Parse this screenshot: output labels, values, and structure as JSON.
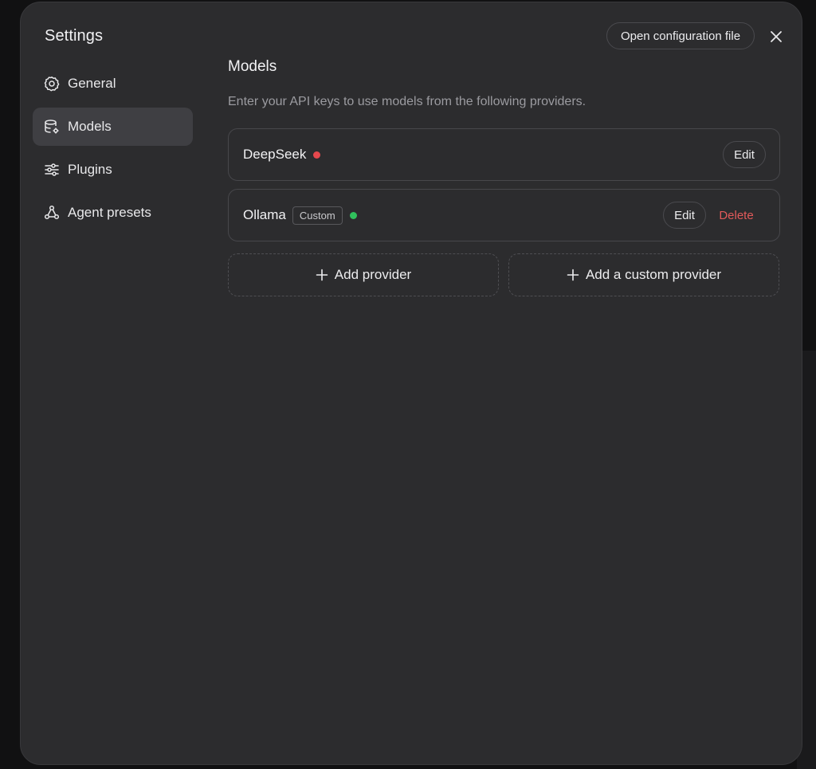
{
  "dialog": {
    "title": "Settings",
    "open_config_label": "Open configuration file",
    "close_icon": "close-icon"
  },
  "sidebar": {
    "items": [
      {
        "label": "General",
        "icon": "gear-icon",
        "active": false
      },
      {
        "label": "Models",
        "icon": "database-gear-icon",
        "active": true
      },
      {
        "label": "Plugins",
        "icon": "sliders-icon",
        "active": false
      },
      {
        "label": "Agent presets",
        "icon": "agent-network-icon",
        "active": false
      }
    ]
  },
  "main": {
    "title": "Models",
    "description": "Enter your API keys to use models from the following providers.",
    "providers": [
      {
        "name": "DeepSeek",
        "tag": "",
        "status_color": "#e5484d",
        "edit_label": "Edit",
        "delete_label": ""
      },
      {
        "name": "Ollama",
        "tag": "Custom",
        "status_color": "#30c15c",
        "edit_label": "Edit",
        "delete_label": "Delete"
      }
    ],
    "add_provider_label": "Add provider",
    "add_custom_provider_label": "Add a custom provider"
  },
  "colors": {
    "dialog_bg": "#2c2c2e",
    "active_nav_bg": "#3f3f43",
    "delete_text": "#e25a5a"
  }
}
